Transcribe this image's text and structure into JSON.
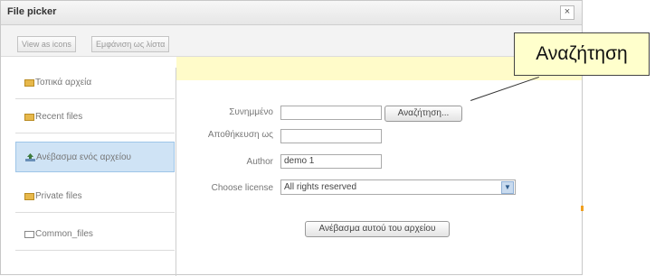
{
  "dialog": {
    "title": "File picker",
    "close_glyph": "×"
  },
  "toolbar": {
    "view_icons_label": "View as icons",
    "view_list_label": "Εμφάνιση ως λίστα"
  },
  "sidebar": {
    "items": [
      {
        "label": "Τοπικά αρχεία",
        "icon": "folder-icon",
        "active": false
      },
      {
        "label": "Recent files",
        "icon": "folder-icon",
        "active": false
      },
      {
        "label": "Ανέβασμα ενός αρχείου",
        "icon": "upload-icon",
        "active": true
      },
      {
        "label": "Private files",
        "icon": "folder-icon",
        "active": false
      },
      {
        "label": "Common_files",
        "icon": "file-icon",
        "active": false
      }
    ]
  },
  "form": {
    "attachment_label": "Συνημμένο",
    "browse_label": "Αναζήτηση...",
    "save_as_label": "Αποθήκευση ως",
    "save_as_value": "",
    "author_label": "Author",
    "author_value": "demo 1",
    "license_label": "Choose license",
    "license_value": "All rights reserved",
    "upload_button": "Ανέβασμα αυτού του αρχείου"
  },
  "callout": {
    "text": "Αναζήτηση"
  }
}
